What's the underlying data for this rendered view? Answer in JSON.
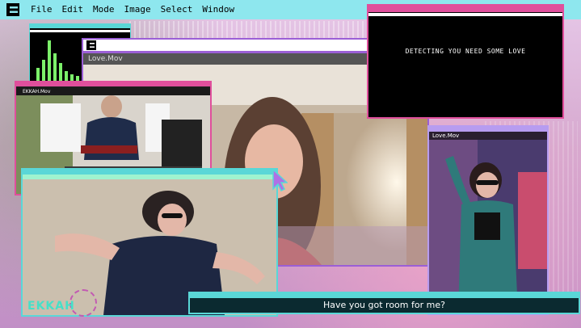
{
  "menubar": {
    "items": [
      "File",
      "Edit",
      "Mode",
      "Image",
      "Select",
      "Window"
    ]
  },
  "windows": {
    "center_title": "Love.Mov",
    "keys_caption": "EKKAH.Mov",
    "dance_title": "Love.Mov"
  },
  "terminal": {
    "message": "DETECTING YOU NEED SOME LOVE"
  },
  "subtitle": {
    "text": "Have you got room for me?"
  },
  "brand": {
    "name": "EKKAH"
  },
  "colors": {
    "menubar": "#8ee7ee",
    "accent_pink": "#e04f9c",
    "accent_purple": "#9b5fd6",
    "accent_teal": "#5ad7d7",
    "brand": "#45e0c8"
  }
}
